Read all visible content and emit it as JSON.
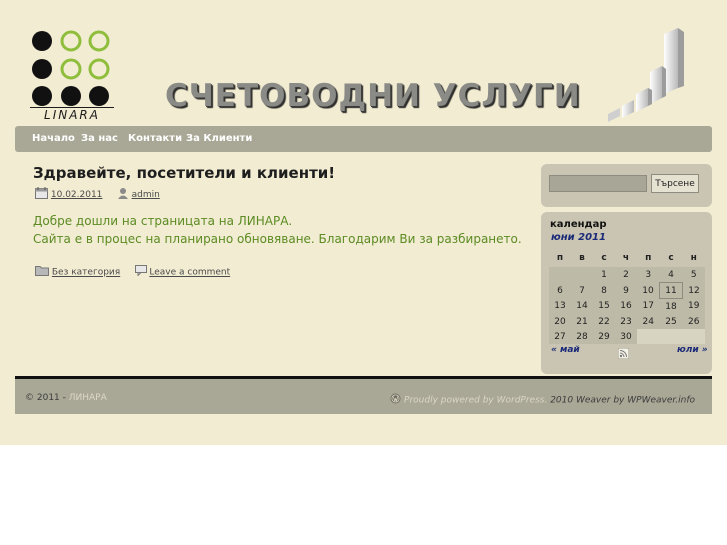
{
  "header": {
    "logo_text": "LINARA",
    "headline": "СЧЕТОВОДНИ УСЛУГИ",
    "colors": {
      "logo_dark": "#111111",
      "logo_green": "#8fbe3c"
    }
  },
  "menu": {
    "items": [
      {
        "label": "Начало"
      },
      {
        "label": "За нас"
      },
      {
        "label": "Контакти"
      },
      {
        "label": "За Клиенти"
      }
    ]
  },
  "post": {
    "title": "Здравейте, посетители и клиенти!",
    "date": "10.02.2011",
    "author": "admin",
    "body_line1": "Добре дошли на страницата на ЛИНАРА.",
    "body_line2": "Сайта е в процес на планирано обновяване. Благодарим Ви за разбирането.",
    "category": "Без категория",
    "comment_link": "Leave a comment"
  },
  "search": {
    "value": "",
    "button_label": "Търсене"
  },
  "calendar": {
    "heading": "календар",
    "caption": "юни 2011",
    "weekdays": [
      "п",
      "в",
      "с",
      "ч",
      "п",
      "с",
      "н"
    ],
    "weeks": [
      [
        "",
        "",
        "1",
        "2",
        "3",
        "4",
        "5"
      ],
      [
        "6",
        "7",
        "8",
        "9",
        "10",
        "11",
        "12"
      ],
      [
        "13",
        "14",
        "15",
        "16",
        "17",
        "18",
        "19"
      ],
      [
        "20",
        "21",
        "22",
        "23",
        "24",
        "25",
        "26"
      ],
      [
        "27",
        "28",
        "29",
        "30",
        "",
        "",
        ""
      ]
    ],
    "today": "11",
    "prev": "« май",
    "next": "юли »",
    "feed_icon": "rss-icon"
  },
  "footer": {
    "copyright": "© 2011 -",
    "site_name": "ЛИНАРА",
    "powered_text": "Proudly powered by WordPress.",
    "theme_text": "2010 Weaver by WPWeaver.info",
    "wp_icon": "wordpress-icon"
  }
}
